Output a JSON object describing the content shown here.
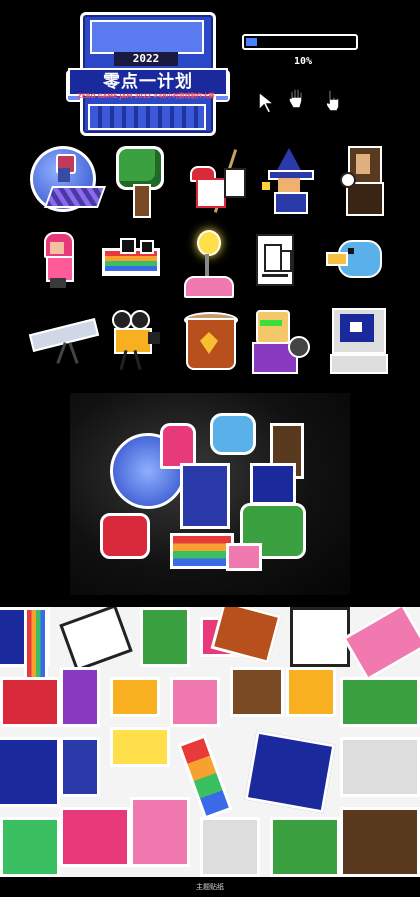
{
  "logo": {
    "year": "2022",
    "title": "零点一计划",
    "subtitle": "ZERO GAME JAM 2022 #48小时游戏制作大赛"
  },
  "progress": {
    "value_percent": 10,
    "label": "10%",
    "fill_color": "#4a80ff"
  },
  "cursors": [
    "arrow-cursor-icon",
    "hand-open-cursor-icon",
    "hand-pointer-cursor-icon"
  ],
  "stickers_row1": [
    "planet-girl-sticker",
    "tree-sticker",
    "painter-sticker",
    "wizard-sticker",
    "mona-lisa-sticker"
  ],
  "stickers_row2": [
    "pink-girl-sticker",
    "rainbow-block-sticker",
    "lamp-sticker",
    "document-sticker",
    "blue-bird-sticker"
  ],
  "stickers_row3": [
    "telescope-sticker",
    "film-camera-sticker",
    "coffee-cup-sticker",
    "thinker-sticker",
    "computer-sticker"
  ],
  "caption": "主题贴纸"
}
